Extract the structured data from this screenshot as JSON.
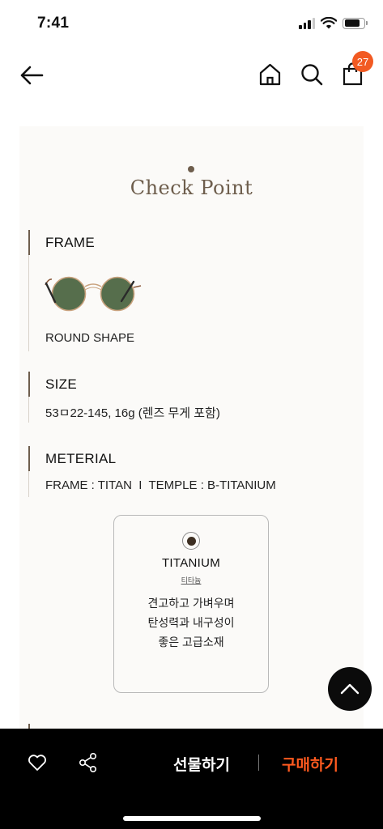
{
  "status": {
    "time": "7:41"
  },
  "header": {
    "cart_count": "27"
  },
  "check_point": {
    "title": "Check Point",
    "frame": {
      "heading": "FRAME",
      "shape": "ROUND SHAPE"
    },
    "size": {
      "heading": "SIZE",
      "value": "53ㅁ22-145, 16g (렌즈 무게 포함)"
    },
    "material": {
      "heading": "METERIAL",
      "value": "FRAME : TITAN  I  TEMPLE : B-TITANIUM",
      "card": {
        "name": "TITANIUM",
        "name_ko": "티타늄",
        "desc_1": "견고하고 가벼우며",
        "desc_2": "탄성력과 내구성이",
        "desc_3": "좋은 고급소재"
      }
    }
  },
  "bottom": {
    "gift_label": "선물하기",
    "buy_label": "구매하기"
  },
  "colors": {
    "accent": "#ff5a1f",
    "brand_brown": "#6e5e4d",
    "badge": "#f25a22"
  },
  "icons": [
    "back-arrow-icon",
    "home-icon",
    "search-icon",
    "shopping-bag-icon",
    "heart-icon",
    "share-icon",
    "chevron-up-icon"
  ]
}
